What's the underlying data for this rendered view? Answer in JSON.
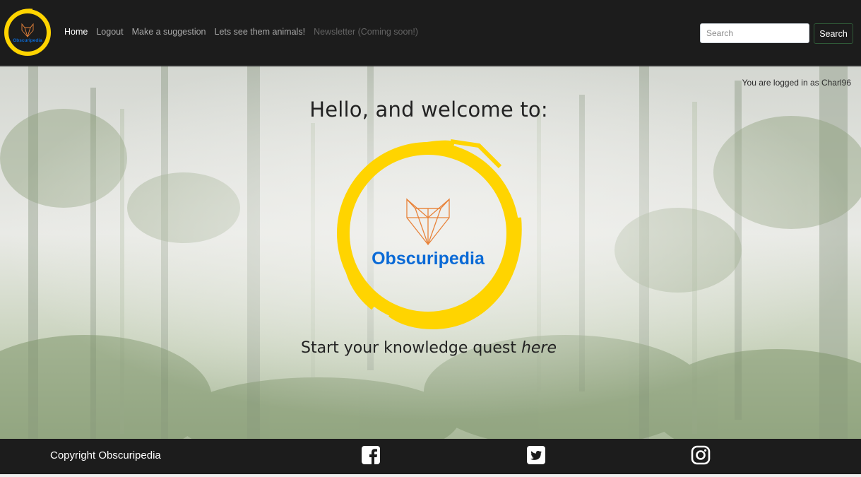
{
  "brand": {
    "name": "Obscuripedia",
    "ring_color": "#ffd400",
    "text_color": "#0a6ad6",
    "fox_color": "#e8833a"
  },
  "nav": {
    "items": [
      {
        "label": "Home",
        "state": "active"
      },
      {
        "label": "Logout",
        "state": "normal"
      },
      {
        "label": "Make a suggestion",
        "state": "normal"
      },
      {
        "label": "Lets see them animals!",
        "state": "normal"
      },
      {
        "label": "Newsletter (Coming soon!)",
        "state": "disabled"
      }
    ],
    "search": {
      "placeholder": "Search",
      "value": "",
      "button_label": "Search"
    }
  },
  "hero": {
    "logged_in_text": "You are logged in as Charl96",
    "welcome": "Hello, and welcome to:",
    "cta_text": "Start your knowledge quest ",
    "cta_link": "here"
  },
  "footer": {
    "copyright": "Copyright Obscuripedia",
    "social": [
      "facebook-icon",
      "twitter-icon",
      "instagram-icon"
    ]
  }
}
